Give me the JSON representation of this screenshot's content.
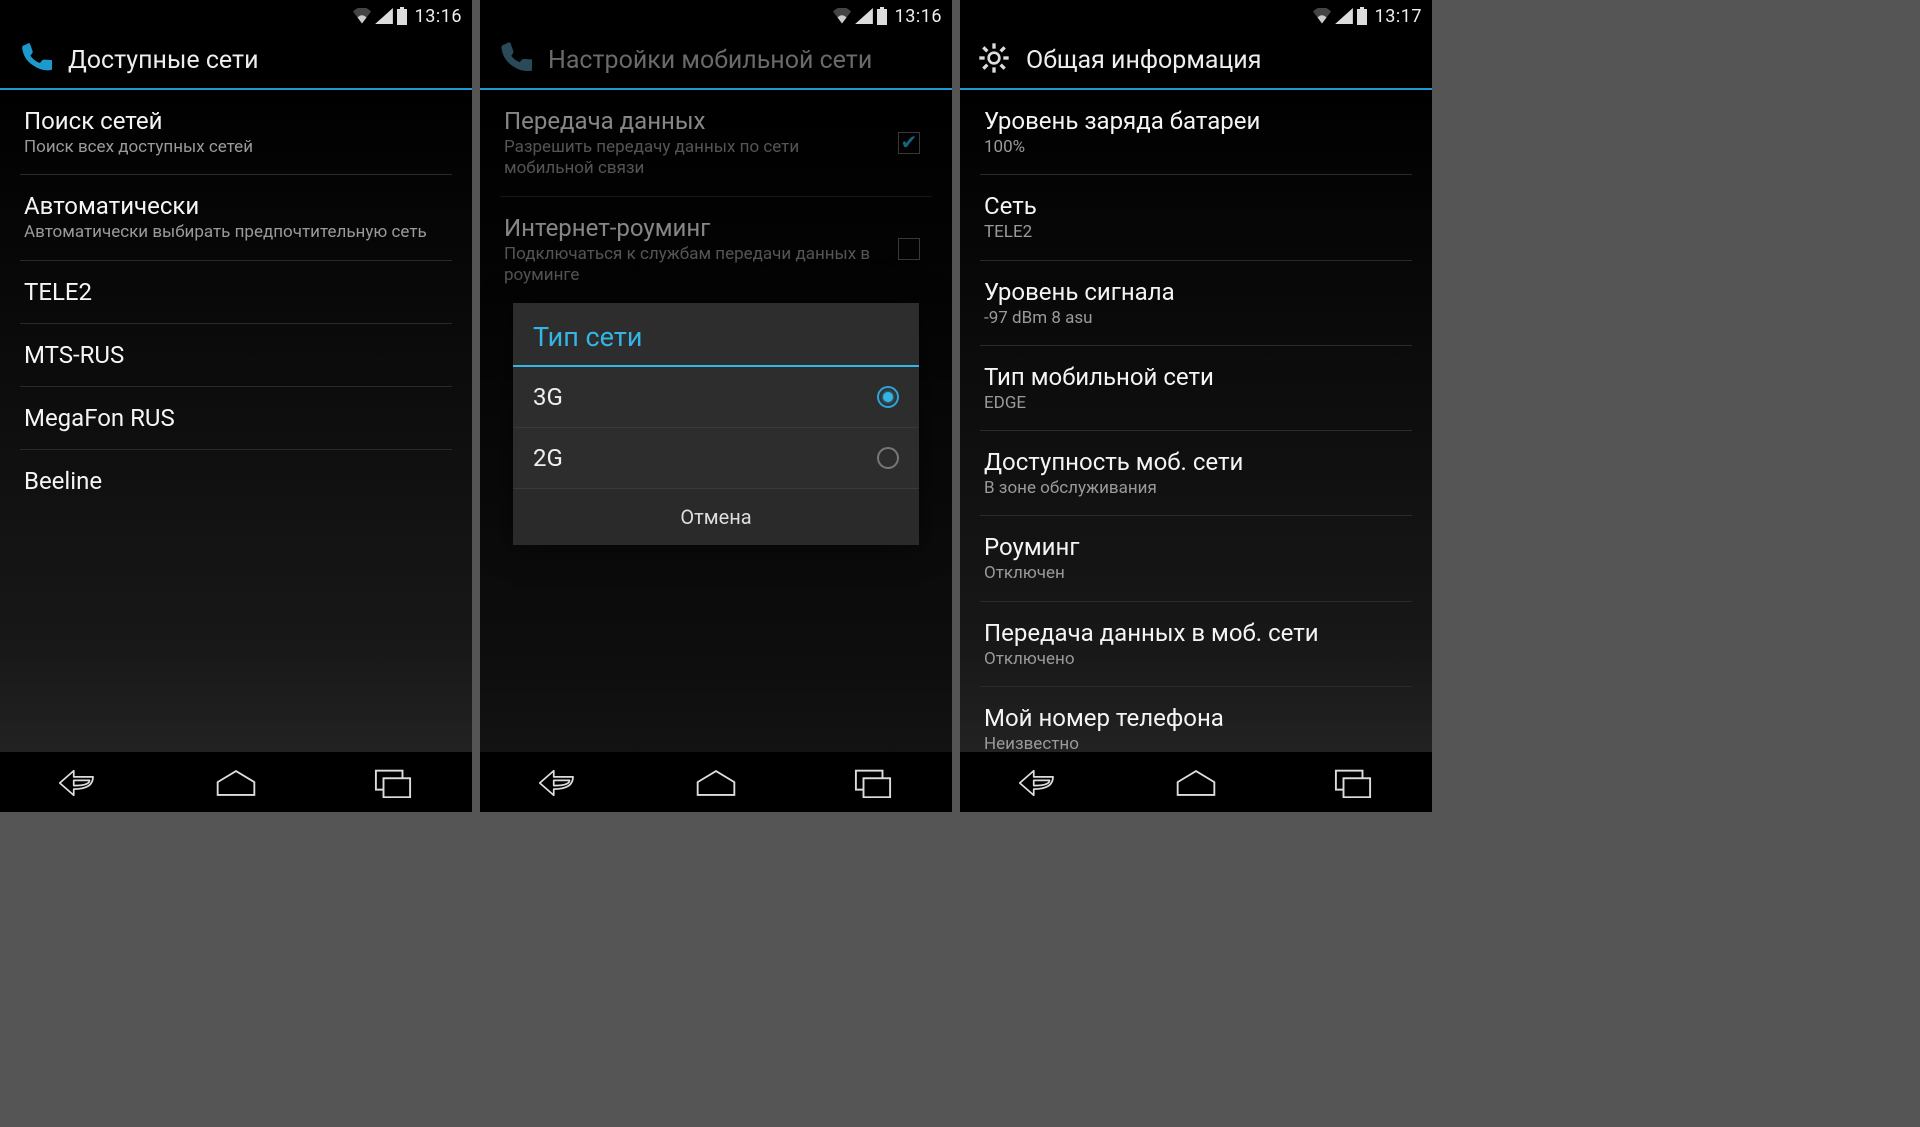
{
  "screens": [
    {
      "status_time": "13:16",
      "title": "Доступные сети",
      "items": [
        {
          "title": "Поиск сетей",
          "sub": "Поиск всех доступных сетей"
        },
        {
          "title": "Автоматически",
          "sub": "Автоматически выбирать предпочтительную сеть"
        },
        {
          "title": "TELE2"
        },
        {
          "title": "MTS-RUS"
        },
        {
          "title": "MegaFon RUS"
        },
        {
          "title": "Beeline"
        }
      ]
    },
    {
      "status_time": "13:16",
      "title": "Настройки мобильной сети",
      "items": [
        {
          "title": "Передача данных",
          "sub": "Разрешить передачу данных по сети мобильной связи",
          "checked": true
        },
        {
          "title": "Интернет-роуминг",
          "sub": "Подключаться к службам передачи данных в роуминге",
          "checked": false
        }
      ],
      "dialog": {
        "title": "Тип сети",
        "options": [
          {
            "label": "3G",
            "selected": true
          },
          {
            "label": "2G",
            "selected": false
          }
        ],
        "cancel": "Отмена"
      }
    },
    {
      "status_time": "13:17",
      "title": "Общая информация",
      "items": [
        {
          "title": "Уровень заряда батареи",
          "sub": "100%"
        },
        {
          "title": "Сеть",
          "sub": "TELE2"
        },
        {
          "title": "Уровень сигнала",
          "sub": "-97 dBm   8 asu"
        },
        {
          "title": "Тип мобильной сети",
          "sub": "EDGE"
        },
        {
          "title": "Доступность моб. сети",
          "sub": "В зоне обслуживания"
        },
        {
          "title": "Роуминг",
          "sub": "Отключен"
        },
        {
          "title": "Передача данных в моб. сети",
          "sub": "Отключено"
        },
        {
          "title": "Мой номер телефона",
          "sub": "Неизвестно"
        }
      ]
    }
  ]
}
